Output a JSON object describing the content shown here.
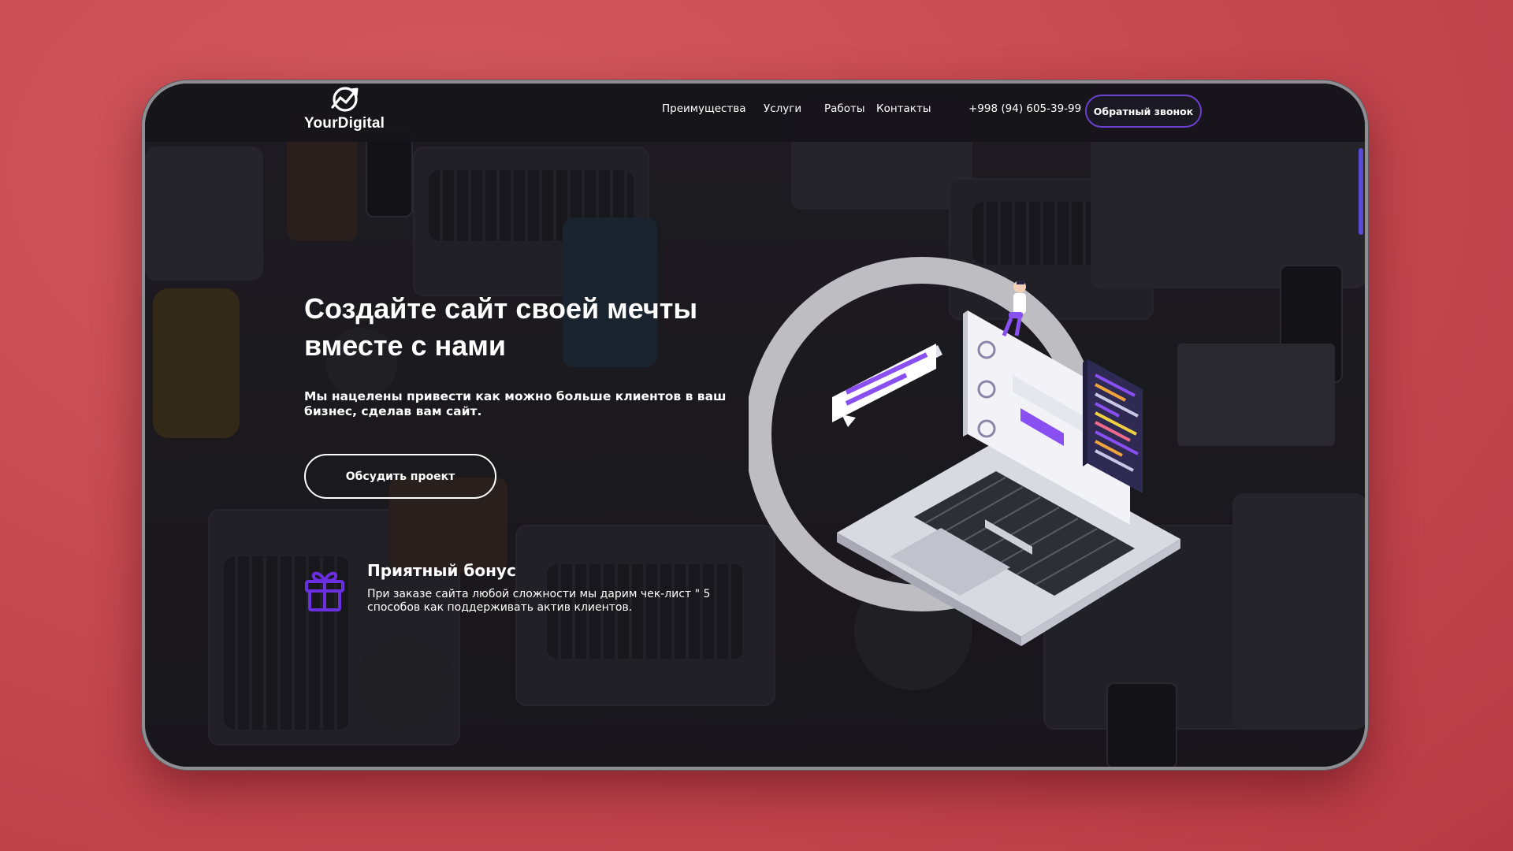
{
  "brand": {
    "name": "YourDigital",
    "accent": "#6b3fd0",
    "background": "#c84a52"
  },
  "nav": {
    "items": [
      "Преимущества",
      "Услуги",
      "Работы",
      "Контакты"
    ],
    "phone": "+998 (94) 605-39-99",
    "callback_label": "Обратный звонок"
  },
  "hero": {
    "title": "Создайте сайт своей мечты вместе с нами",
    "subtitle": "Мы нацелены привести как можно больше клиентов в ваш бизнес, сделав вам сайт.",
    "cta_label": "Обсудить проект"
  },
  "bonus": {
    "title": "Приятный бонус",
    "text": "При заказе сайта любой сложности мы дарим чек-лист \" 5 способов как поддерживать актив клиентов.",
    "icon": "gift-icon"
  },
  "illustration": {
    "name": "laptop-illustration"
  }
}
